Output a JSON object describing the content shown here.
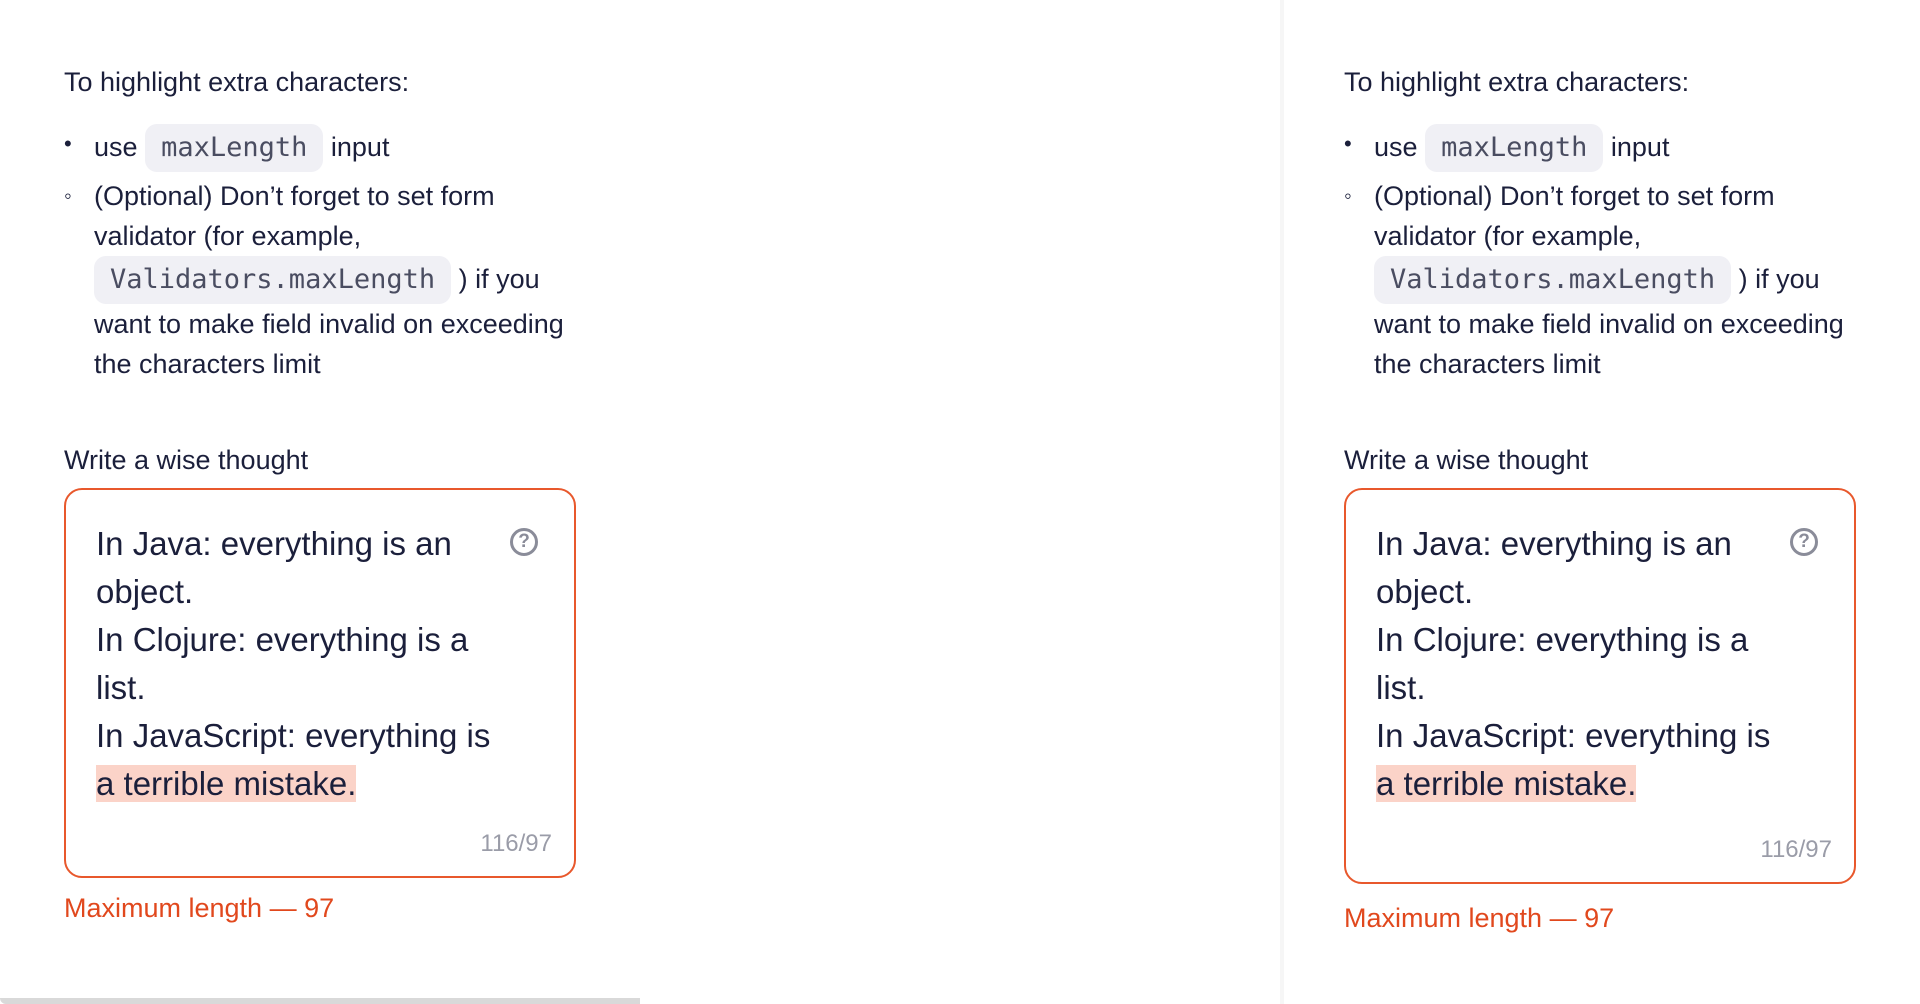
{
  "panels": [
    {
      "intro": "To highlight extra characters:",
      "bullet1": {
        "marker": "•",
        "before": "use",
        "code": "maxLength",
        "after": "input"
      },
      "bullet2": {
        "marker": "◦",
        "text_part1": "(Optional) Don’t forget to set form validator (for example,",
        "code": "Validators.maxLength",
        "text_part2": ") if you want to make field invalid on exceeding the characters limit"
      },
      "field_label": "Write a wise thought",
      "textarea": {
        "line1": "In Java: everything is an object.",
        "line2": "In Clojure: everything is a list.",
        "line3_plain": "In JavaScript: everything is ",
        "line3_highlight": "a terrible mistake.",
        "help_icon": "?",
        "counter": "116/97"
      },
      "error": "Maximum length — 97"
    },
    {
      "intro": "To highlight extra characters:",
      "bullet1": {
        "marker": "•",
        "before": "use",
        "code": "maxLength",
        "after": "input"
      },
      "bullet2": {
        "marker": "◦",
        "text_part1": "(Optional) Don’t forget to set form validator (for example,",
        "code": "Validators.maxLength",
        "text_part2": ") if you want to make field invalid on exceeding the characters limit"
      },
      "field_label": "Write a wise thought",
      "textarea": {
        "line1": "In Java: everything is an object.",
        "line2": "In Clojure: everything is a list.",
        "line3_plain": "In JavaScript: everything is ",
        "line3_highlight": "a terrible mistake.",
        "help_icon": "?",
        "counter": "116/97"
      },
      "error": "Maximum length — 97"
    }
  ],
  "colors": {
    "error": "#e1481d",
    "border_error": "#e8582c",
    "highlight": "#fbd3c8",
    "text": "#1b1f3b",
    "muted": "#9a9ca8"
  }
}
